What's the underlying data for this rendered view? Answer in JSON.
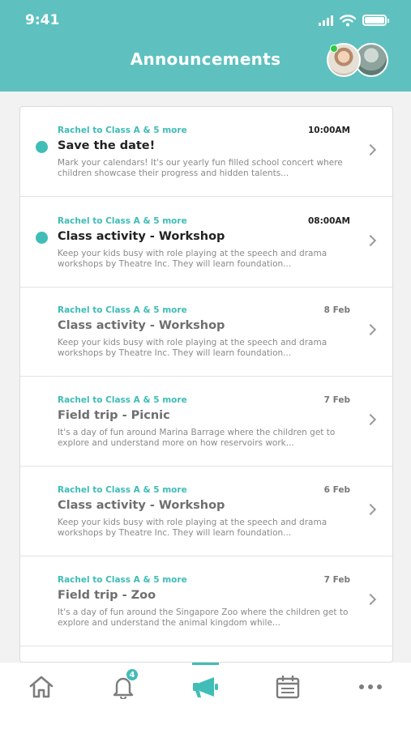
{
  "status_bar": {
    "time": "9:41"
  },
  "header": {
    "title": "Announcements"
  },
  "announcements": [
    {
      "sender": "Rachel to Class A & 5 more",
      "time": "10:00AM",
      "title": "Save the date!",
      "preview": "Mark your calendars! It's our yearly fun filled school concert where children showcase their progress and hidden talents...",
      "unread": true
    },
    {
      "sender": "Rachel to Class A & 5 more",
      "time": "08:00AM",
      "title": "Class activity - Workshop",
      "preview": "Keep your kids busy with role playing at the speech and drama workshops by Theatre Inc. They will learn foundation...",
      "unread": true
    },
    {
      "sender": "Rachel to Class A & 5 more",
      "time": "8 Feb",
      "title": "Class activity - Workshop",
      "preview": "Keep your kids busy with role playing at the speech and drama workshops by Theatre Inc. They will learn foundation...",
      "unread": false
    },
    {
      "sender": "Rachel to Class A & 5 more",
      "time": "7 Feb",
      "title": "Field trip - Picnic",
      "preview": "It's a day of fun around Marina Barrage where the children get to explore and understand more on how reservoirs work...",
      "unread": false
    },
    {
      "sender": "Rachel to Class A & 5 more",
      "time": "6 Feb",
      "title": "Class activity - Workshop",
      "preview": "Keep your kids busy with role playing at the speech and drama workshops by Theatre Inc. They will learn foundation...",
      "unread": false
    },
    {
      "sender": "Rachel to Class A & 5 more",
      "time": "7 Feb",
      "title": "Field trip - Zoo",
      "preview": "It's a day of fun around the Singapore Zoo where the children get to explore and understand the animal kingdom while...",
      "unread": false
    }
  ],
  "tab_bar": {
    "tabs": [
      {
        "icon": "home-icon",
        "active": false
      },
      {
        "icon": "bell-icon",
        "active": false,
        "badge": "4"
      },
      {
        "icon": "megaphone-icon",
        "active": true
      },
      {
        "icon": "calendar-icon",
        "active": false
      },
      {
        "icon": "more-icon",
        "active": false
      }
    ]
  },
  "colors": {
    "accent": "#5ec1bf",
    "unread_dot": "#41bdb7",
    "sender_text": "#3ebcb6",
    "badge": "#41bdb7"
  }
}
